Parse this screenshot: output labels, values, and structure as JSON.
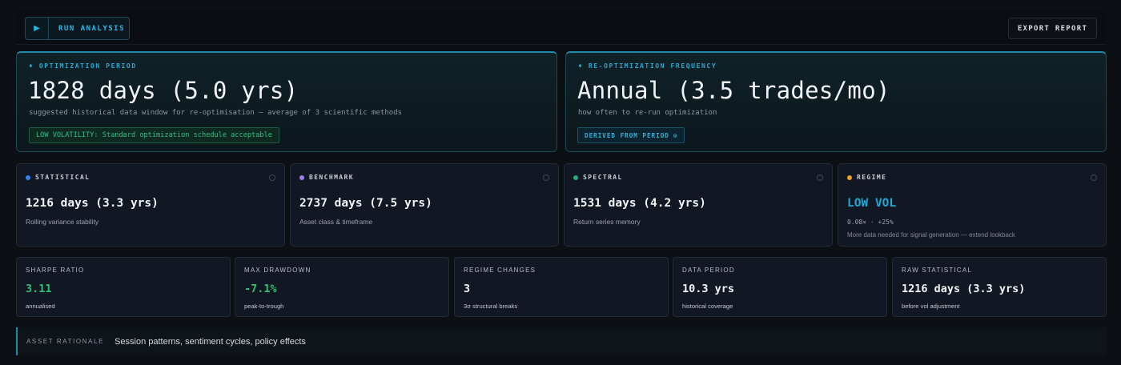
{
  "toolbar": {
    "run_label": "RUN ANALYSIS",
    "run_icon": "play-icon",
    "export_label": "EXPORT REPORT"
  },
  "optimization_period": {
    "label": "OPTIMIZATION PERIOD",
    "value": "1828 days (5.0 yrs)",
    "subtitle": "suggested historical data window for re-optimisation — average of 3 scientific methods",
    "badge": "LOW VOLATILITY: Standard optimization schedule acceptable"
  },
  "reoptimization_frequency": {
    "label": "RE-OPTIMIZATION FREQUENCY",
    "value": "Annual (3.5 trades/mo)",
    "subtitle": "how often to re-run optimization",
    "badge": "DERIVED FROM PERIOD",
    "badge_icon": "info-icon"
  },
  "methods": [
    {
      "label": "STATISTICAL",
      "value": "1216 days (3.3 yrs)",
      "subtitle": "Rolling variance stability",
      "color": "#2f86f0"
    },
    {
      "label": "BENCHMARK",
      "value": "2737 days (7.5 yrs)",
      "subtitle": "Asset class & timeframe",
      "color": "#a27cf0"
    },
    {
      "label": "SPECTRAL",
      "value": "1531 days (4.2 yrs)",
      "subtitle": "Return series memory",
      "color": "#22b07a"
    },
    {
      "label": "REGIME",
      "value": "LOW VOL",
      "metric": "0.08× · +25%",
      "subtitle": "More data needed for signal generation — extend lookback",
      "color": "#f0a020"
    }
  ],
  "stats": [
    {
      "label": "SHARPE RATIO",
      "value": "3.11",
      "subtitle": "annualised"
    },
    {
      "label": "MAX DRAWDOWN",
      "value": "-7.1%",
      "subtitle": "peak-to-trough"
    },
    {
      "label": "REGIME CHANGES",
      "value": "3",
      "subtitle": "3σ structural breaks"
    },
    {
      "label": "DATA PERIOD",
      "value": "10.3 yrs",
      "subtitle": "historical coverage"
    },
    {
      "label": "RAW STATISTICAL",
      "value": "1216 days (3.3 yrs)",
      "subtitle": "before vol adjustment"
    }
  ],
  "rationale": {
    "label": "ASSET RATIONALE",
    "text": "Session patterns, sentiment cycles, policy effects"
  }
}
